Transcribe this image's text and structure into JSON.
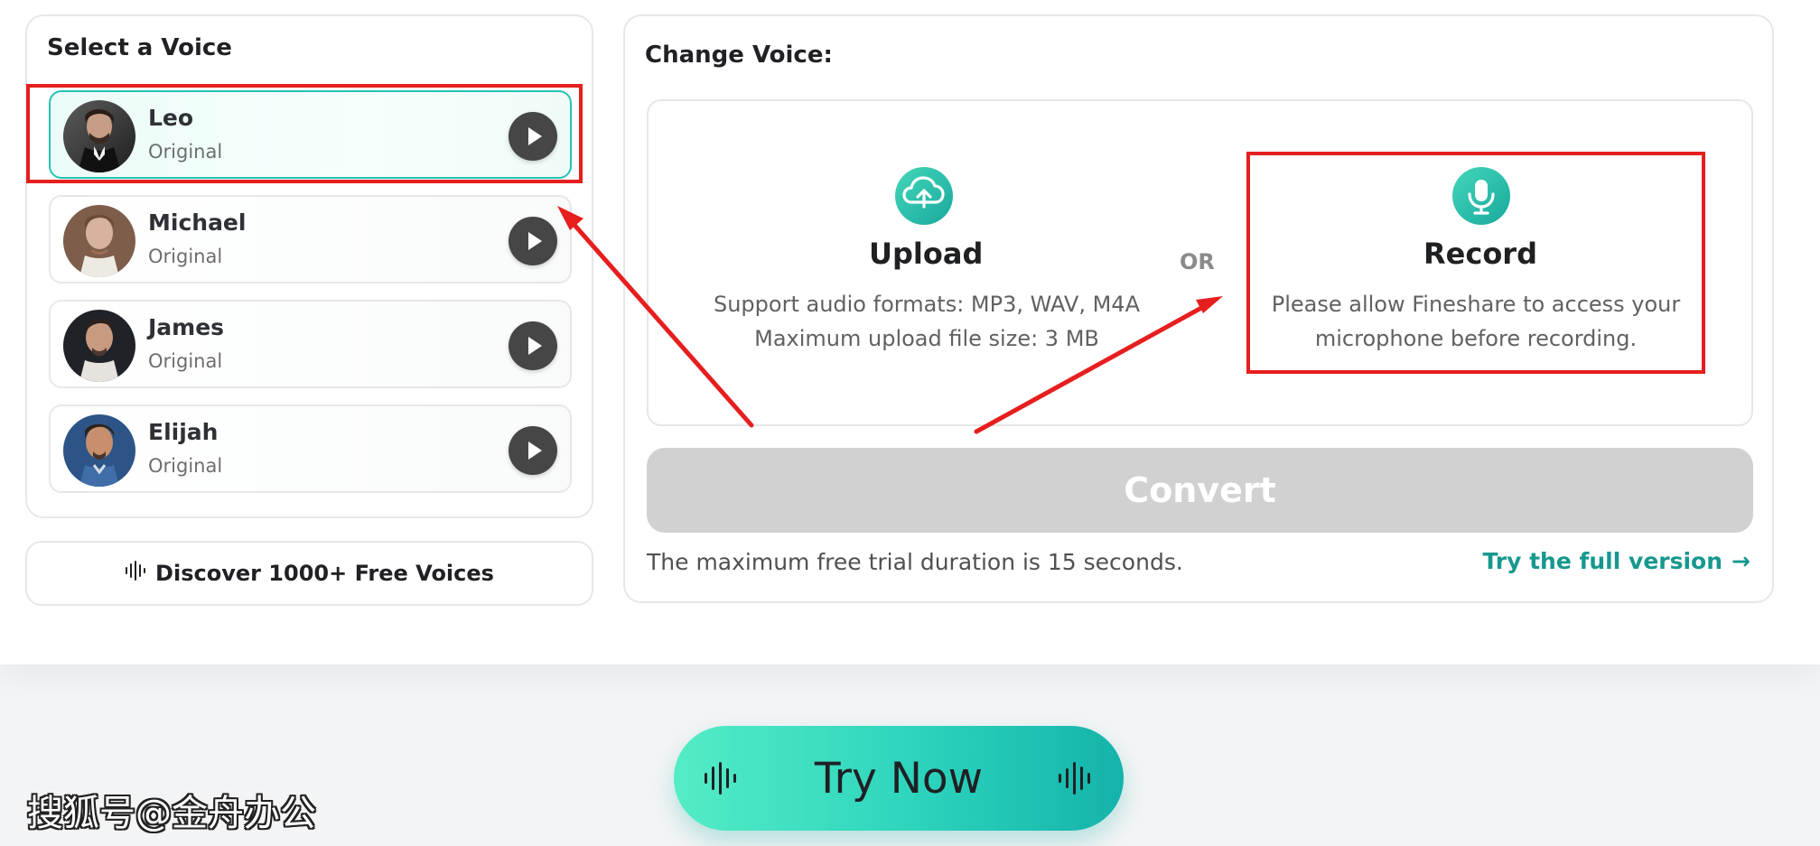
{
  "left_panel": {
    "title": "Select a Voice",
    "voices": [
      {
        "name": "Leo",
        "subtitle": "Original"
      },
      {
        "name": "Michael",
        "subtitle": "Original"
      },
      {
        "name": "James",
        "subtitle": "Original"
      },
      {
        "name": "Elijah",
        "subtitle": "Original"
      }
    ],
    "discover_label": "Discover 1000+ Free Voices"
  },
  "right_panel": {
    "title": "Change Voice:",
    "upload": {
      "heading": "Upload",
      "line1": "Support audio formats: MP3, WAV, M4A",
      "line2": "Maximum upload file size: 3 MB"
    },
    "or_label": "OR",
    "record": {
      "heading": "Record",
      "line1": "Please allow Fineshare to access your",
      "line2": "microphone before recording."
    },
    "convert_label": "Convert",
    "trial_text": "The maximum free trial duration is 15 seconds.",
    "full_version_label": "Try the full version",
    "full_version_arrow": "→"
  },
  "cta": {
    "label": "Try Now"
  },
  "watermark": {
    "text": "搜狐号@金舟办公"
  },
  "colors": {
    "teal": "#17988e",
    "teal_light": "#42d7ba",
    "highlight_red": "#e61e1e",
    "disabled_gray": "#d1d1d1"
  },
  "icons": {
    "play": "play-icon",
    "upload": "cloud-upload-icon",
    "record": "microphone-icon",
    "wave": "sound-wave-icon"
  }
}
